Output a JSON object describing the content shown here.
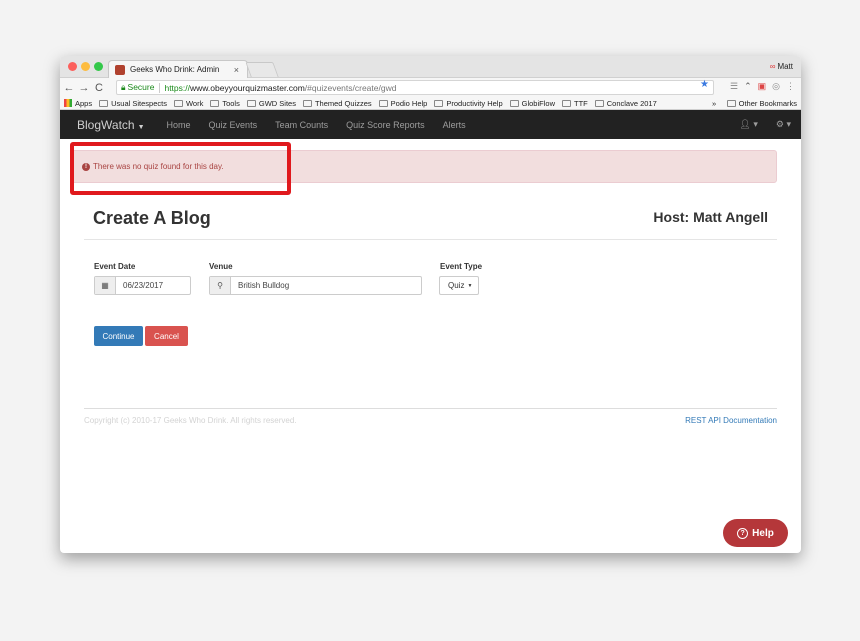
{
  "browser": {
    "tab_title": "Geeks Who Drink: Admin",
    "tab_close": "×",
    "profile_name": "Matt",
    "profile_icon": "infinity-icon",
    "back": "←",
    "forward": "→",
    "reload": "C",
    "secure_label": "Secure",
    "url_scheme": "https://",
    "url_domain": "www.obeyyourquizmaster.com",
    "url_path": "/#quizevents/create/gwd",
    "bookmarks": [
      "Apps",
      "Usual Sitespects",
      "Work",
      "Tools",
      "GWD Sites",
      "Themed Quizzes",
      "Podio Help",
      "Productivity Help",
      "GlobiFlow",
      "TTF",
      "Conclave 2017"
    ],
    "bookmarks_more": "»",
    "other_bookmarks": "Other Bookmarks"
  },
  "nav": {
    "brand": "BlogWatch",
    "links": [
      "Home",
      "Quiz Events",
      "Team Counts",
      "Quiz Score Reports",
      "Alerts"
    ]
  },
  "alert": {
    "icon": "exclamation-circle-icon",
    "message": "There was no quiz found for this day."
  },
  "page": {
    "title": "Create A Blog",
    "host": "Host: Matt Angell"
  },
  "form": {
    "event_date_label": "Event Date",
    "event_date_value": "06/23/2017",
    "venue_label": "Venue",
    "venue_value": "British Bulldog",
    "event_type_label": "Event Type",
    "event_type_value": "Quiz"
  },
  "buttons": {
    "continue": "Continue",
    "cancel": "Cancel"
  },
  "footer": {
    "copyright": "Copyright (c) 2010-17 Geeks Who Drink. All rights reserved.",
    "api_link": "REST API Documentation"
  },
  "help": {
    "label": "Help"
  },
  "colors": {
    "primary": "#337ab7",
    "danger": "#d9534f",
    "alert_bg": "#f2dede",
    "highlight": "#e0191d",
    "help": "#b5373a"
  }
}
